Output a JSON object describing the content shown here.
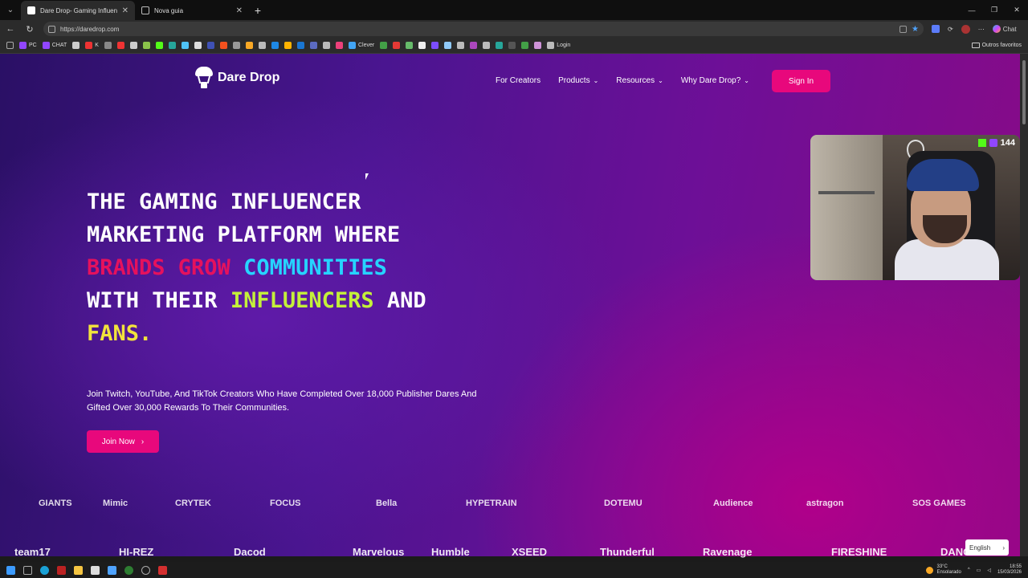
{
  "browser": {
    "tabs": [
      {
        "title": "Dare Drop- Gaming Influencer Ma",
        "active": true
      },
      {
        "title": "Nova guia",
        "active": false
      }
    ],
    "url": "https://daredrop.com",
    "chat_label": "Chat",
    "bookmarks": [
      {
        "label": "PC",
        "color": "#9146ff"
      },
      {
        "label": "CHAT",
        "color": "#9146ff"
      },
      {
        "label": "",
        "color": "#cccccc"
      },
      {
        "label": "K",
        "color": "#e33"
      },
      {
        "label": "",
        "color": "#888"
      },
      {
        "label": "",
        "color": "#e33"
      },
      {
        "label": "",
        "color": "#ccc"
      },
      {
        "label": "",
        "color": "#8bc34a"
      },
      {
        "label": "",
        "color": "#53fc18"
      },
      {
        "label": "",
        "color": "#26a69a"
      },
      {
        "label": "",
        "color": "#4fc3f7"
      },
      {
        "label": "",
        "color": "#ddd"
      },
      {
        "label": "",
        "color": "#3f51b5"
      },
      {
        "label": "",
        "color": "#f4511e"
      },
      {
        "label": "",
        "color": "#999"
      },
      {
        "label": "",
        "color": "#f9a825"
      },
      {
        "label": "",
        "color": "#bbb"
      },
      {
        "label": "",
        "color": "#1e88e5"
      },
      {
        "label": "",
        "color": "#ffb300"
      },
      {
        "label": "",
        "color": "#1976d2"
      },
      {
        "label": "",
        "color": "#5c6bc0"
      },
      {
        "label": "",
        "color": "#bbb"
      },
      {
        "label": "",
        "color": "#ec407a"
      },
      {
        "label": "Clever",
        "color": "#42a5f5"
      },
      {
        "label": "",
        "color": "#43a047"
      },
      {
        "label": "",
        "color": "#e53935"
      },
      {
        "label": "",
        "color": "#66bb6a"
      },
      {
        "label": "",
        "color": "#eee"
      },
      {
        "label": "",
        "color": "#7c4dff"
      },
      {
        "label": "",
        "color": "#90caf9"
      },
      {
        "label": "",
        "color": "#bbb"
      },
      {
        "label": "",
        "color": "#ab47bc"
      },
      {
        "label": "",
        "color": "#bbb"
      },
      {
        "label": "",
        "color": "#26a69a"
      },
      {
        "label": "",
        "color": "#555"
      },
      {
        "label": "",
        "color": "#43a047"
      },
      {
        "label": "",
        "color": "#ce93d8"
      },
      {
        "label": "Login",
        "color": "#bbb"
      }
    ],
    "bookmarks_folder": "Outros favoritos"
  },
  "site": {
    "brand": "Dare Drop",
    "nav": [
      {
        "label": "For Creators",
        "dropdown": false
      },
      {
        "label": "Products",
        "dropdown": true
      },
      {
        "label": "Resources",
        "dropdown": true
      },
      {
        "label": "Why Dare Drop?",
        "dropdown": true
      }
    ],
    "signin": "Sign In",
    "hero": {
      "l1": "THE GAMING INFLUENCER",
      "l2": "MARKETING PLATFORM WHERE",
      "l3a": "BRANDS GROW",
      "l3b": "COMMUNITIES",
      "l4a": "WITH THEIR",
      "l4b": "INFLUENCERS",
      "l4c": "AND",
      "l5": "FANS."
    },
    "subtitle": "Join Twitch, YouTube, And TikTok Creators Who Have Completed Over 18,000 Publisher Dares And Gifted Over 30,000 Rewards To Their Communities.",
    "join_label": "Join Now",
    "partner_logos_row1": [
      "GIANTS",
      "Mimic",
      "CRYTEK",
      "FOCUS",
      "Bella",
      "HYPETRAIN",
      "DOTEMU",
      "Audience",
      "astragon",
      "SOS GAMES"
    ],
    "partner_logos_row2": [
      "team17",
      "HI-REZ",
      "Dacod",
      "Marvelous",
      "Humble",
      "XSEED",
      "Thunderful",
      "Ravenage",
      "FIRESHINE",
      "DANGE"
    ],
    "language": "English"
  },
  "stream_overlay": {
    "viewers": "144"
  },
  "taskbar": {
    "weather_temp": "33°C",
    "weather_desc": "Ensolarado",
    "time": "18:55",
    "date": "15/03/2026"
  },
  "colors": {
    "accent_pink": "#e8087c",
    "hero_pink": "#e5115d",
    "hero_cyan": "#26d4ff",
    "hero_lime": "#c4f03a",
    "hero_yellow": "#f2e33c"
  }
}
